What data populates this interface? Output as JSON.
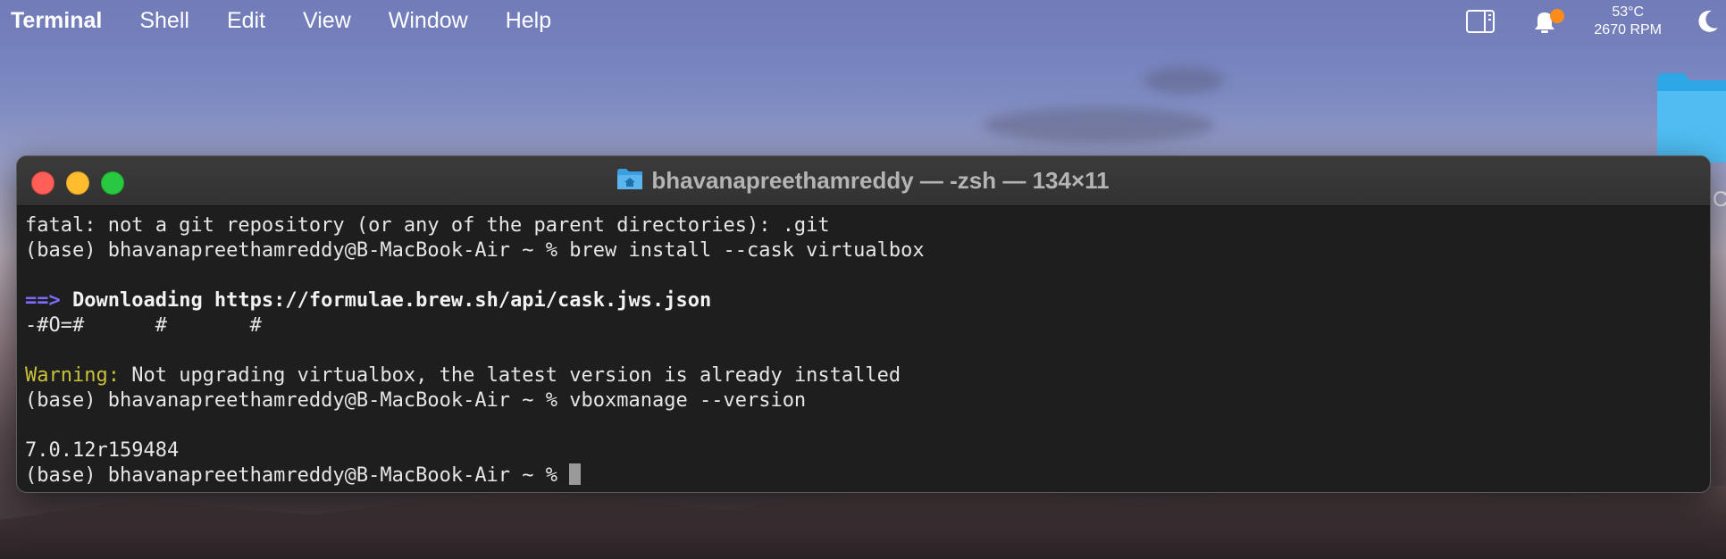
{
  "menubar": {
    "app": "Terminal",
    "items": [
      "Shell",
      "Edit",
      "View",
      "Window",
      "Help"
    ],
    "temperature": "53°C",
    "fan": "2670 RPM"
  },
  "window": {
    "title": "bhavanapreethamreddy — -zsh — 134×11"
  },
  "terminal": {
    "l1": "fatal: not a git repository (or any of the parent directories): .git",
    "l2": "(base) bhavanapreethamreddy@B-MacBook-Air ~ % brew install --cask virtualbox",
    "l4_arrow": "==>",
    "l4_text": " Downloading https://formulae.brew.sh/api/cask.jws.json",
    "l5": "-#O=#      #       #",
    "l7_warn": "Warning:",
    "l7_text": " Not upgrading virtualbox, the latest version is already installed",
    "l8": "(base) bhavanapreethamreddy@B-MacBook-Air ~ % vboxmanage --version",
    "l10": "7.0.12r159484",
    "l11": "(base) bhavanapreethamreddy@B-MacBook-Air ~ % "
  },
  "desktop": {
    "partial_label": "C"
  },
  "colors": {
    "close": "#ff5f57",
    "minimize": "#febc2e",
    "maximize": "#28c840",
    "prompt_arrow": "#7b6cff",
    "warning": "#c9c13a"
  }
}
